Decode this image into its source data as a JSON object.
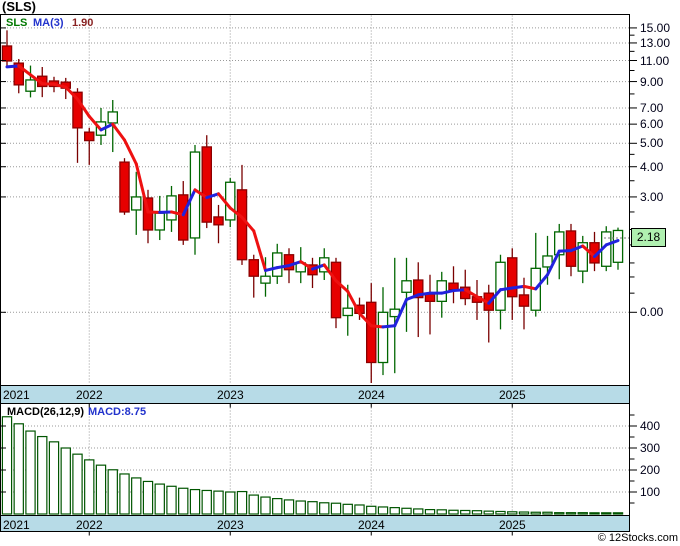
{
  "title": "(SLS)",
  "legend": {
    "symbol": "SLS",
    "ma_label": "MA(3)",
    "ma_value": "1.90"
  },
  "price_badge": "2.18",
  "footer": "© 12Stocks.com",
  "macd_header": "MACD(26,12,9)",
  "macd_current": "MACD:8.75",
  "colors": {
    "up_body_fill": "#ffffff",
    "up_body_stroke": "#006600",
    "up_wick": "#006600",
    "down_body_fill": "#e60000",
    "down_body_stroke": "#8b0000",
    "down_wick": "#7a0000",
    "ma_up": "#2222dd",
    "ma_down": "#ee1111",
    "grid": "#999999",
    "strip_bg": "#b7dbe7",
    "badge_bg": "#b0f0b0",
    "macd_bar_fill": "#ffffff",
    "macd_bar_stroke": "#005500",
    "legend_symbol": "#007700",
    "legend_ma": "#2233cc",
    "legend_ma_value": "#882222",
    "macd_current": "#2233cc",
    "border": "#000000"
  },
  "price_axis": {
    "labels": [
      {
        "text": "15.00",
        "value": 15
      },
      {
        "text": "13.00",
        "value": 13
      },
      {
        "text": "11.00",
        "value": 11
      },
      {
        "text": "9.00",
        "value": 9
      },
      {
        "text": "7.00",
        "value": 7
      },
      {
        "text": "6.00",
        "value": 6
      },
      {
        "text": "5.00",
        "value": 5
      },
      {
        "text": "4.00",
        "value": 4
      },
      {
        "text": "3.00",
        "value": 3
      },
      {
        "text": "0.00",
        "value": 1.0
      }
    ],
    "minor_ticks": [
      14,
      12,
      10,
      8,
      4.5,
      3.5,
      2.6,
      2.2,
      1.9,
      1.6,
      1.4,
      1.2
    ]
  },
  "chart_data": {
    "type": "candlestick",
    "symbol": "SLS",
    "interval": "monthly",
    "price_scale": "log",
    "last_price": 2.18,
    "ma3_last": 1.9,
    "years": [
      {
        "label": "2021",
        "line_index": -5
      },
      {
        "label": "2022",
        "line_index": 7
      },
      {
        "label": "2023",
        "line_index": 19
      },
      {
        "label": "2024",
        "line_index": 31
      },
      {
        "label": "2025",
        "line_index": 43
      }
    ],
    "candles_ohlc": [
      [
        12.63,
        14.66,
        10.24,
        10.95
      ],
      [
        10.73,
        11.16,
        8.05,
        8.72
      ],
      [
        8.21,
        10.48,
        7.74,
        9.14
      ],
      [
        9.47,
        10.34,
        7.76,
        8.59
      ],
      [
        9.05,
        9.42,
        8.13,
        8.59
      ],
      [
        8.95,
        9.32,
        7.62,
        8.45
      ],
      [
        8.13,
        8.45,
        4.15,
        5.79
      ],
      [
        5.56,
        5.79,
        4.07,
        5.13
      ],
      [
        5.4,
        7.0,
        4.92,
        6.13
      ],
      [
        6.07,
        7.55,
        4.6,
        6.74
      ],
      [
        4.18,
        4.34,
        2.53,
        2.6
      ],
      [
        2.65,
        3.81,
        2.09,
        3.0
      ],
      [
        2.97,
        3.21,
        1.93,
        2.19
      ],
      [
        2.19,
        3.03,
        1.99,
        2.57
      ],
      [
        2.41,
        3.33,
        2.15,
        3.03
      ],
      [
        3.06,
        3.49,
        1.9,
        1.99
      ],
      [
        2.03,
        4.92,
        1.73,
        4.6
      ],
      [
        4.83,
        5.4,
        2.23,
        2.36
      ],
      [
        2.48,
        2.78,
        1.93,
        2.3
      ],
      [
        2.41,
        3.59,
        2.25,
        3.45
      ],
      [
        3.21,
        4.07,
        1.57,
        1.65
      ],
      [
        1.65,
        1.73,
        1.15,
        1.41
      ],
      [
        1.32,
        1.69,
        1.16,
        1.41
      ],
      [
        1.41,
        1.92,
        1.31,
        1.76
      ],
      [
        1.73,
        1.84,
        1.32,
        1.5
      ],
      [
        1.47,
        1.86,
        1.32,
        1.6
      ],
      [
        1.57,
        1.68,
        1.26,
        1.43
      ],
      [
        1.47,
        1.84,
        1.36,
        1.68
      ],
      [
        1.61,
        1.68,
        0.86,
        0.95
      ],
      [
        0.97,
        1.3,
        0.8,
        1.04
      ],
      [
        1.07,
        1.15,
        0.93,
        0.99
      ],
      [
        1.1,
        1.32,
        0.51,
        0.62
      ],
      [
        0.62,
        1.27,
        0.55,
        1.0
      ],
      [
        0.96,
        1.68,
        0.56,
        1.03
      ],
      [
        1.21,
        1.68,
        0.83,
        1.35
      ],
      [
        1.36,
        1.61,
        0.79,
        1.15
      ],
      [
        1.19,
        1.43,
        0.81,
        1.11
      ],
      [
        1.11,
        1.47,
        0.95,
        1.35
      ],
      [
        1.32,
        1.55,
        1.09,
        1.24
      ],
      [
        1.27,
        1.5,
        1.07,
        1.14
      ],
      [
        1.16,
        1.36,
        0.93,
        1.1
      ],
      [
        1.2,
        1.3,
        0.75,
        1.02
      ],
      [
        1.02,
        1.73,
        0.85,
        1.61
      ],
      [
        1.68,
        1.84,
        0.93,
        1.16
      ],
      [
        1.18,
        1.39,
        0.85,
        1.06
      ],
      [
        1.02,
        2.13,
        0.96,
        1.52
      ],
      [
        1.54,
        2.07,
        1.3,
        1.71
      ],
      [
        1.73,
        2.32,
        1.37,
        2.15
      ],
      [
        2.17,
        2.32,
        1.41,
        1.55
      ],
      [
        1.48,
        2.07,
        1.32,
        1.94
      ],
      [
        1.94,
        2.15,
        1.48,
        1.6
      ],
      [
        1.55,
        2.27,
        1.48,
        2.15
      ],
      [
        1.61,
        2.24,
        1.5,
        2.18
      ]
    ],
    "ma3": [
      10.35,
      10.45,
      9.6,
      8.82,
      8.77,
      8.54,
      7.61,
      6.46,
      5.68,
      6.0,
      5.16,
      4.11,
      2.6,
      2.59,
      2.6,
      2.53,
      3.21,
      2.98,
      3.09,
      2.7,
      2.47,
      2.17,
      1.49,
      1.53,
      1.56,
      1.62,
      1.51,
      1.57,
      1.35,
      1.22,
      0.99,
      0.88,
      0.87,
      0.88,
      1.13,
      1.18,
      1.2,
      1.2,
      1.23,
      1.24,
      1.16,
      1.09,
      1.24,
      1.26,
      1.28,
      1.25,
      1.43,
      1.79,
      1.8,
      1.88,
      1.7,
      1.9,
      1.98
    ],
    "macd": {
      "params": "26,12,9",
      "current": 8.75,
      "values": [
        442,
        410,
        377,
        352,
        328,
        300,
        272,
        246,
        222,
        201,
        182,
        164,
        148,
        136,
        126,
        117,
        111,
        107,
        104,
        100,
        102,
        86,
        77,
        70,
        64,
        59,
        56,
        51,
        49,
        44,
        41,
        35,
        32,
        29,
        26,
        23,
        20,
        19,
        17,
        16,
        15,
        13,
        11.5,
        10,
        9,
        8,
        8,
        6,
        6,
        6,
        4,
        4,
        4
      ],
      "axis_labels": [
        {
          "text": "400",
          "value": 400
        },
        {
          "text": "300",
          "value": 300
        },
        {
          "text": "200",
          "value": 200
        },
        {
          "text": "100",
          "value": 100
        }
      ],
      "minor_ticks": [
        450,
        350,
        250,
        150,
        50
      ]
    }
  }
}
